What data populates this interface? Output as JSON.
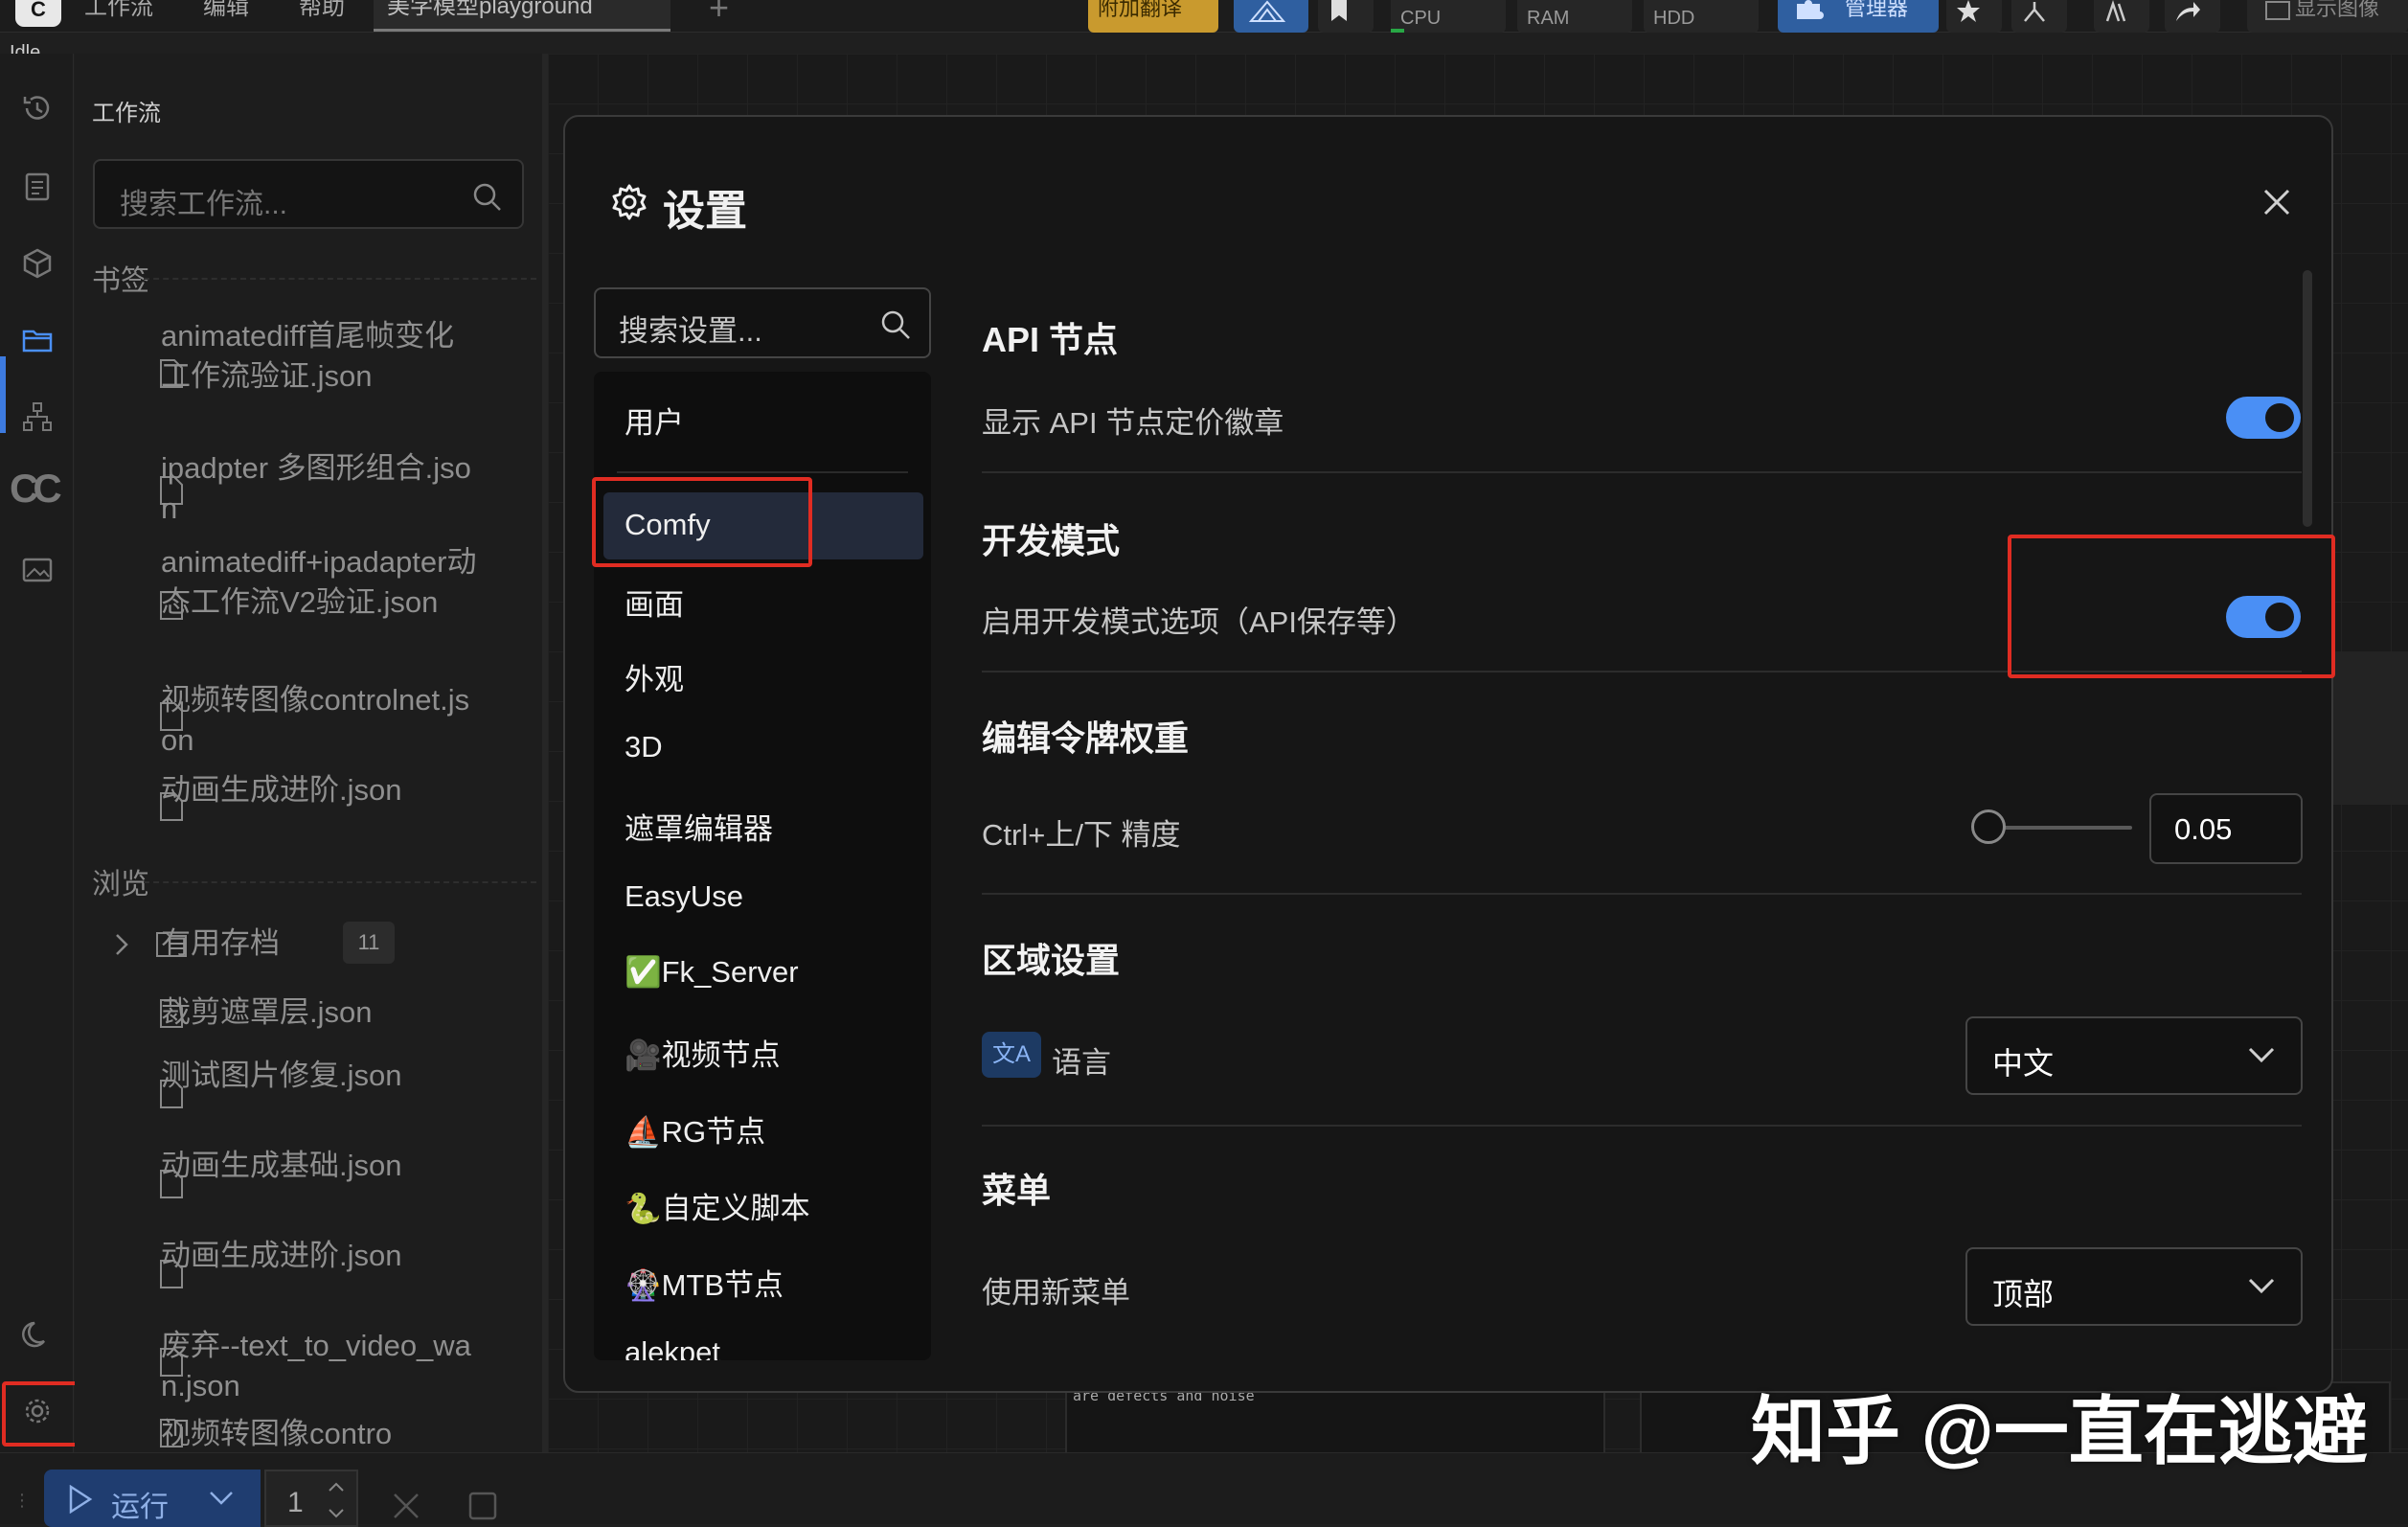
{
  "menubar": {
    "items": [
      "工作流",
      "编辑",
      "帮助"
    ],
    "active_tab": "美学模型playground",
    "translate_btn": "附加翻译",
    "stats": [
      {
        "label": "CPU",
        "level": 0.1
      },
      {
        "label": "RAM",
        "level": 0.0
      },
      {
        "label": "HDD",
        "level": 0.0
      }
    ],
    "manager_btn": "管理器",
    "show_image_btn": "显示图像"
  },
  "status": "Idle",
  "sidebar": {
    "title": "工作流",
    "search_placeholder": "搜索工作流...",
    "bookmarks_heading": "书签",
    "bookmarks": [
      "animatediff首尾帧变化工作流验证.json",
      "ipadpter 多图形组合.json",
      "animatediff+ipadapter动态工作流V2验证.json",
      "视频转图像controlnet.json",
      "动画生成进阶.json"
    ],
    "browse_heading": "浏览",
    "folder": {
      "name": "有用存档",
      "count": "11"
    },
    "browse_items": [
      "裁剪遮罩层.json",
      "测试图片修复.json",
      "动画生成基础.json",
      "动画生成进阶.json",
      "废弃--text_to_video_wan.json",
      "视频转图像contro"
    ]
  },
  "runbar": {
    "run_label": "运行",
    "queue_count": "1"
  },
  "canvas": {
    "node_text": "are defects and noise"
  },
  "settings": {
    "title": "设置",
    "search_placeholder": "搜索设置...",
    "categories": [
      "用户",
      "Comfy",
      "画面",
      "外观",
      "3D",
      "遮罩编辑器",
      "EasyUse",
      "✅Fk_Server",
      "🎥视频节点",
      "⛵RG节点",
      "🐍自定义脚本",
      "🎡MTB节点",
      "alekpet"
    ],
    "selected_category": "Comfy",
    "sections": {
      "api_nodes": {
        "title": "API 节点",
        "label": "显示 API 节点定价徽章",
        "enabled": true
      },
      "dev_mode": {
        "title": "开发模式",
        "label": "启用开发模式选项（API保存等）",
        "enabled": true
      },
      "token_weight": {
        "title": "编辑令牌权重",
        "label": "Ctrl+上/下 精度",
        "value": "0.05"
      },
      "locale": {
        "title": "区域设置",
        "label": "语言",
        "value": "中文"
      },
      "menu": {
        "title": "菜单",
        "label": "使用新菜单",
        "value": "顶部"
      }
    }
  },
  "watermark": "知乎 @一直在逃避",
  "colors": {
    "accent": "#4a8ff5",
    "highlight_box": "#e02c22",
    "run_button": "#1f3d70"
  }
}
